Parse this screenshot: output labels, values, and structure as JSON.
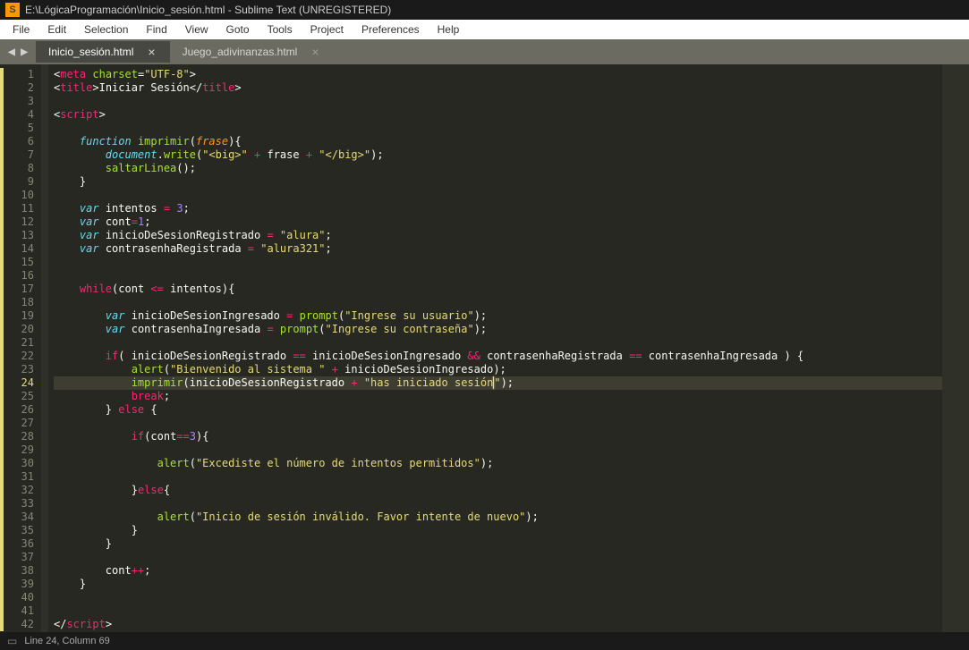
{
  "titlebar": {
    "path": "E:\\LógicaProgramación\\Inicio_sesión.html",
    "app": "Sublime Text (UNREGISTERED)",
    "icon_letter": "S"
  },
  "menu": [
    "File",
    "Edit",
    "Selection",
    "Find",
    "View",
    "Goto",
    "Tools",
    "Project",
    "Preferences",
    "Help"
  ],
  "tabs": [
    {
      "label": "Inicio_sesión.html",
      "active": true
    },
    {
      "label": "Juego_adivinanzas.html",
      "active": false
    }
  ],
  "code_lines": 42,
  "active_line": 24,
  "mod_lines": [
    1,
    2,
    3,
    4,
    5,
    6,
    7,
    8,
    9,
    10,
    11,
    12,
    13,
    14,
    15,
    16,
    17,
    18,
    19,
    20,
    21,
    22,
    23,
    24,
    25,
    26,
    27,
    28,
    29,
    30,
    31,
    32,
    33,
    34,
    35,
    36,
    37,
    38,
    39,
    40,
    41,
    42
  ],
  "code": {
    "l1": {
      "tag_open": "<",
      "tag": "meta",
      "attr": "charset",
      "eq": "=",
      "val": "\"UTF-8\"",
      "tag_close": ">"
    },
    "l2": {
      "tag_open": "<",
      "tag": "title",
      "tag_close": ">",
      "text": "Iniciar Sesión",
      "end_open": "</",
      "end_tag": "title",
      "end_close": ">"
    },
    "l4": {
      "tag_open": "<",
      "tag": "script",
      "tag_close": ">"
    },
    "l6_a": "function",
    "l6_fn": "imprimir",
    "l6_p": "frase",
    "l7_a": "document",
    "l7_b": "write",
    "l7_s1": "\"<big>\"",
    "l7_op": "+",
    "l7_v": "frase",
    "l7_s2": "\"</big>\"",
    "l8_fn": "saltarLinea",
    "l11_kw": "var",
    "l11_v": "intentos",
    "l11_n": "3",
    "l12_kw": "var",
    "l12_v": "cont",
    "l12_n": "1",
    "l13_kw": "var",
    "l13_v": "inicioDeSesionRegistrado",
    "l13_s": "\"alura\"",
    "l14_kw": "var",
    "l14_v": "contrasenhaRegistrada",
    "l14_s": "\"alura321\"",
    "l17_kw": "while",
    "l17_v1": "cont",
    "l17_op": "<=",
    "l17_v2": "intentos",
    "l19_kw": "var",
    "l19_v": "inicioDeSesionIngresado",
    "l19_fn": "prompt",
    "l19_s": "\"Ingrese su usuario\"",
    "l20_kw": "var",
    "l20_v": "contrasenhaIngresada",
    "l20_fn": "prompt",
    "l20_s": "\"Ingrese su contraseña\"",
    "l22_kw": "if",
    "l22_a": "inicioDeSesionRegistrado",
    "l22_op1": "==",
    "l22_b": "inicioDeSesionIngresado",
    "l22_and": "&&",
    "l22_c": "contrasenhaRegistrada",
    "l22_op2": "==",
    "l22_d": "contrasenhaIngresada",
    "l23_fn": "alert",
    "l23_s": "\"Bienvenido al sistema \"",
    "l23_op": "+",
    "l23_v": "inicioDeSesionIngresado",
    "l24_fn": "imprimir",
    "l24_v": "inicioDeSesionRegistrado",
    "l24_op": "+",
    "l24_s1": "\"has iniciado sesión",
    "l24_s2": "\"",
    "l25_kw": "break",
    "l26_kw": "else",
    "l28_kw": "if",
    "l28_v": "cont",
    "l28_op": "==",
    "l28_n": "3",
    "l30_fn": "alert",
    "l30_s": "\"Excediste el número de intentos permitidos\"",
    "l32_kw": "else",
    "l34_fn": "alert",
    "l34_s": "\"Inicio de sesión inválido. Favor intente de nuevo\"",
    "l38_v": "cont",
    "l38_op": "++",
    "l42": {
      "end_open": "</",
      "tag": "script",
      "end_close": ">"
    }
  },
  "status": {
    "text": "Line 24, Column 69"
  }
}
